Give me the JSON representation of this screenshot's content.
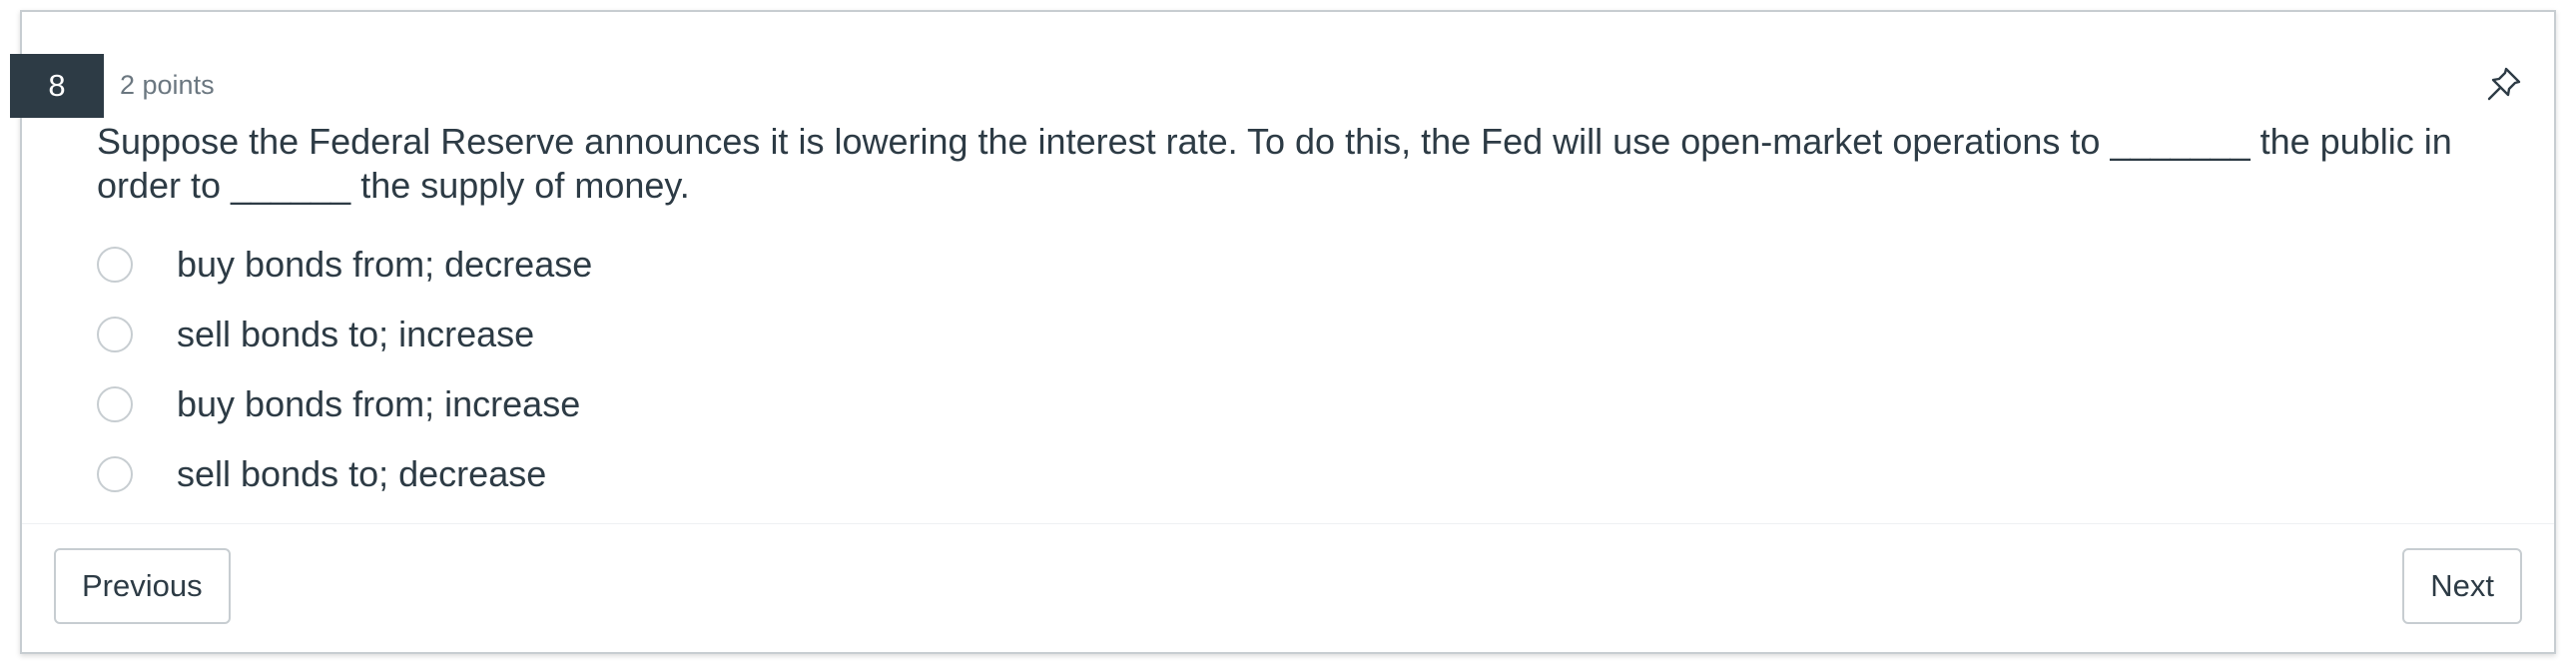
{
  "question": {
    "number": "8",
    "points": "2 points",
    "text": "Suppose the Federal Reserve announces it is lowering the interest rate. To do this, the Fed will use open-market operations to _______ the public in order to ______ the supply of money.",
    "options": [
      {
        "label": "buy bonds from; decrease"
      },
      {
        "label": "sell bonds to; increase"
      },
      {
        "label": "buy bonds from; increase"
      },
      {
        "label": "sell bonds to; decrease"
      }
    ]
  },
  "navigation": {
    "previous_label": "Previous",
    "next_label": "Next"
  },
  "icons": {
    "pin": "pin-icon"
  },
  "colors": {
    "badge_bg": "#2d3b45",
    "text": "#2d3b45",
    "border": "#c7cdd1"
  }
}
